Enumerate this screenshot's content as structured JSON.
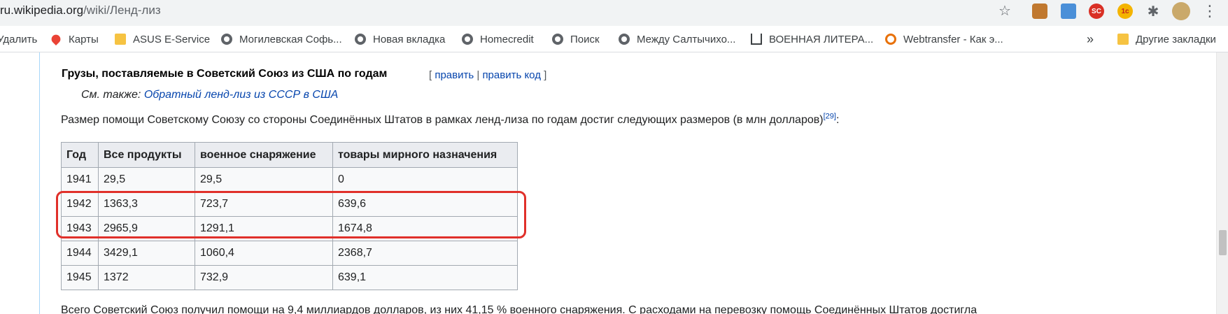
{
  "browser": {
    "url_host": "ru.wikipedia.org",
    "url_path": "/wiki/Ленд-лиз"
  },
  "bookmarks": [
    {
      "label": "Удалить",
      "icon": "none"
    },
    {
      "label": "Карты",
      "icon": "map-pin-icon"
    },
    {
      "label": "ASUS E-Service",
      "icon": "folder-icon"
    },
    {
      "label": "Могилевская Софь...",
      "icon": "globe-icon"
    },
    {
      "label": "Новая вкладка",
      "icon": "globe-icon"
    },
    {
      "label": "Homecredit",
      "icon": "globe-icon"
    },
    {
      "label": "Поиск",
      "icon": "globe-icon"
    },
    {
      "label": "Между Салтычихо...",
      "icon": "globe-icon"
    },
    {
      "label": "ВОЕННАЯ ЛИТЕРА...",
      "icon": "book-icon"
    },
    {
      "label": "Webtransfer - Как э...",
      "icon": "loop-icon"
    }
  ],
  "bookmarks_overflow": "»",
  "other_bookmarks": "Другие закладки",
  "extensions": {
    "ext3": "SC",
    "ext4": "1с"
  },
  "article": {
    "heading": "Грузы, поставляемые в Советский Союз из США по годам",
    "edit_open": "[",
    "edit_link": "править",
    "edit_sep": "|",
    "edit_code_link": "править код",
    "edit_close": "]",
    "see_also_prefix": "См. также:",
    "see_also_link": "Обратный ленд-лиз из СССР в США",
    "intro_text": "Размер помощи Советскому Союзу со стороны Соединённых Штатов в рамках ленд-лиза по годам достиг следующих размеров (в млн долларов)",
    "intro_ref": "[29]",
    "intro_end": ":",
    "summary": "Всего Советский Союз получил помощи на 9,4 миллиардов долларов, из них 41,15 % военного снаряжения. С расходами на перевозку помощь Соединённых Штатов достигла"
  },
  "table": {
    "headers": [
      "Год",
      "Все продукты",
      "военное снаряжение",
      "товары мирного назначения"
    ],
    "rows": [
      [
        "1941",
        "29,5",
        "29,5",
        "0"
      ],
      [
        "1942",
        "1363,3",
        "723,7",
        "639,6"
      ],
      [
        "1943",
        "2965,9",
        "1291,1",
        "1674,8"
      ],
      [
        "1944",
        "3429,1",
        "1060,4",
        "2368,7"
      ],
      [
        "1945",
        "1372",
        "732,9",
        "639,1"
      ]
    ]
  },
  "colors": {
    "highlight": "#e0302a",
    "link": "#0645ad"
  }
}
